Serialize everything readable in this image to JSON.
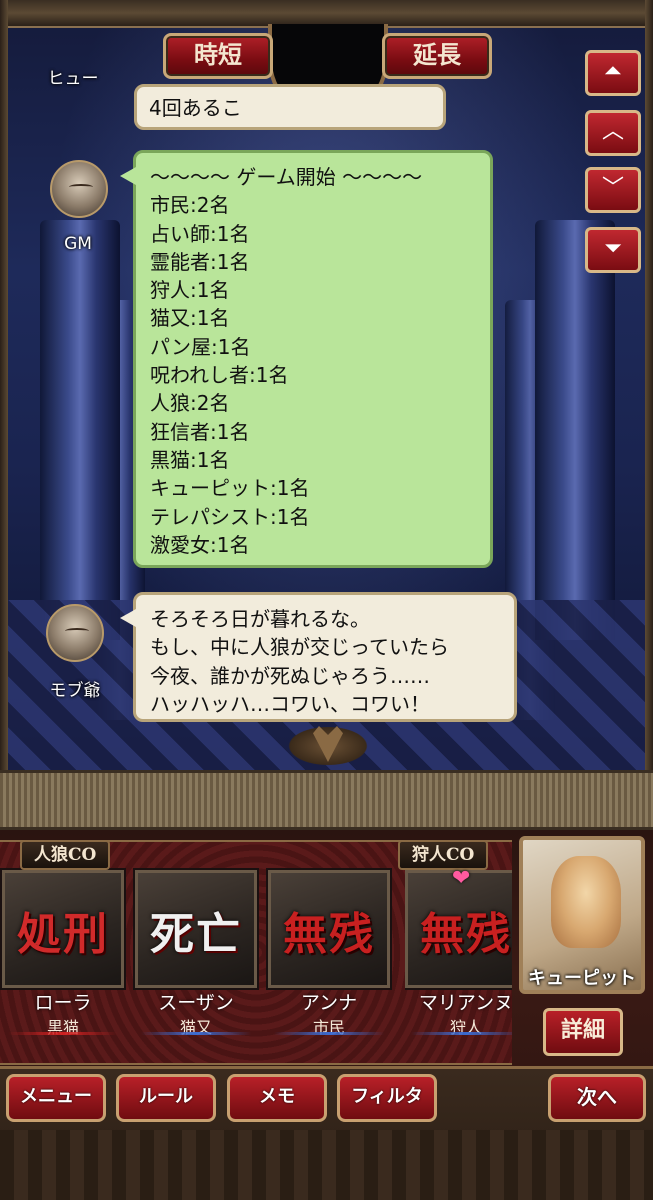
{
  "header": {
    "short_label": "時短",
    "extend_label": "延長"
  },
  "scroll_buttons": [
    "top",
    "up",
    "down",
    "bottom"
  ],
  "messages": {
    "previous": {
      "speaker": "ヒュー",
      "text": "4回あるこ"
    },
    "gm": {
      "speaker": "GM",
      "lines": [
        "～～～～ ゲーム開始 ～～～～",
        "市民:2名",
        "占い師:1名",
        "霊能者:1名",
        "狩人:1名",
        "猫又:1名",
        "パン屋:1名",
        "呪われし者:1名",
        "人狼:2名",
        "狂信者:1名",
        "黒猫:1名",
        "キューピット:1名",
        "テレパシスト:1名",
        "激愛女:1名"
      ]
    },
    "mob": {
      "speaker": "モブ爺",
      "lines": [
        "そろそろ日が暮れるな。",
        "もし、中に人狼が交じっていたら",
        "今夜、誰かが死ぬじゃろう……",
        "ハッハッハ…コワい、コワい！"
      ]
    }
  },
  "co_tags": {
    "werewolf": "人狼CO",
    "hunter": "狩人CO"
  },
  "players": [
    {
      "name": "ローラ",
      "status": "処刑",
      "role": "黒猫",
      "role_color": "#d02020"
    },
    {
      "name": "スーザン",
      "status": "死亡",
      "role": "猫又",
      "role_color": "#3a6ad0"
    },
    {
      "name": "アンナ",
      "status": "無残",
      "role": "市民",
      "role_color": "#3a6ad0"
    },
    {
      "name": "マリアンヌ",
      "status": "無残",
      "role": "狩人",
      "role_color": "#3a6ad0"
    }
  ],
  "self_card": {
    "role_label": "キューピット",
    "detail_label": "詳細"
  },
  "menu": {
    "menu_label": "メニュー",
    "rules_label": "ルール",
    "memo_label": "メモ",
    "filter_label": "フィルタ",
    "next_label": "次へ"
  }
}
